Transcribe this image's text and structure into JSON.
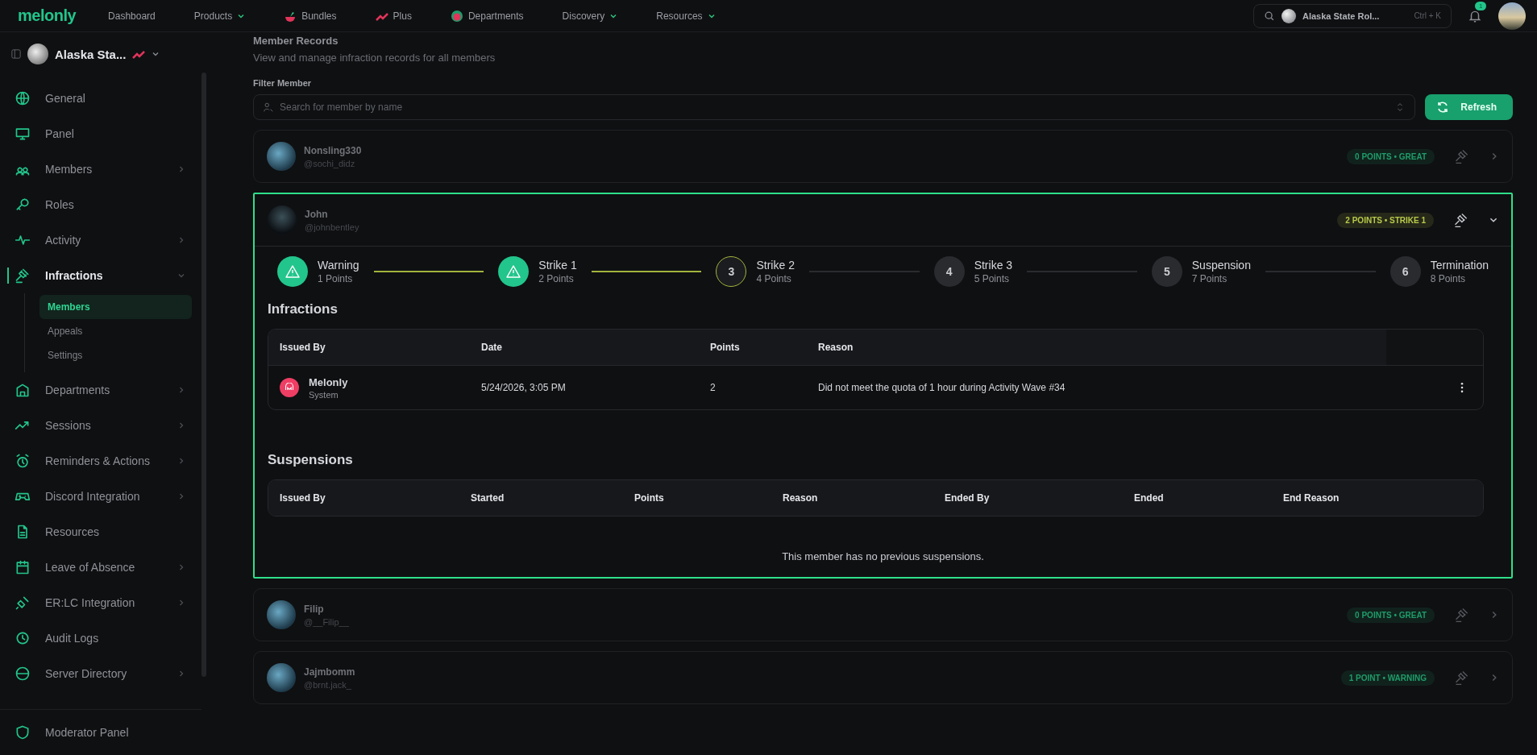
{
  "topbar": {
    "logo": "melonly",
    "nav": [
      {
        "label": "Dashboard",
        "dropdown": false
      },
      {
        "label": "Products",
        "dropdown": true
      },
      {
        "label": "Bundles",
        "dropdown": false
      },
      {
        "label": "Plus",
        "dropdown": false
      },
      {
        "label": "Departments",
        "dropdown": false
      },
      {
        "label": "Discovery",
        "dropdown": true
      },
      {
        "label": "Resources",
        "dropdown": true
      }
    ],
    "search": {
      "value": "Alaska State Rol...",
      "shortcut": "Ctrl + K"
    },
    "notifications": "1"
  },
  "sidebar": {
    "server": "Alaska Sta...",
    "items": [
      {
        "label": "General",
        "submenu": false,
        "active": false
      },
      {
        "label": "Panel",
        "submenu": false,
        "active": false
      },
      {
        "label": "Members",
        "submenu": true,
        "active": false,
        "expanded": false
      },
      {
        "label": "Roles",
        "submenu": false,
        "active": false
      },
      {
        "label": "Activity",
        "submenu": true,
        "active": false,
        "expanded": false
      },
      {
        "label": "Infractions",
        "submenu": true,
        "active": true,
        "expanded": true,
        "children": [
          {
            "label": "Members",
            "selected": true
          },
          {
            "label": "Appeals",
            "selected": false
          },
          {
            "label": "Settings",
            "selected": false
          }
        ]
      },
      {
        "label": "Departments",
        "submenu": true,
        "active": false,
        "expanded": false
      },
      {
        "label": "Sessions",
        "submenu": true,
        "active": false,
        "expanded": false
      },
      {
        "label": "Reminders & Actions",
        "submenu": true,
        "active": false,
        "expanded": false
      },
      {
        "label": "Discord Integration",
        "submenu": true,
        "active": false,
        "expanded": false
      },
      {
        "label": "Resources",
        "submenu": false,
        "active": false
      },
      {
        "label": "Leave of Absence",
        "submenu": true,
        "active": false,
        "expanded": false
      },
      {
        "label": "ER:LC Integration",
        "submenu": true,
        "active": false,
        "expanded": false
      },
      {
        "label": "Audit Logs",
        "submenu": false,
        "active": false
      },
      {
        "label": "Server Directory",
        "submenu": true,
        "active": false,
        "expanded": false
      }
    ],
    "footer": "Moderator Panel"
  },
  "page": {
    "title": "Member Records",
    "subtitle": "View and manage infraction records for all members",
    "filter_label": "Filter Member",
    "search": {
      "placeholder": "Search for member by name"
    },
    "refresh": "Refresh"
  },
  "members": [
    {
      "name": "Nonsling330",
      "handle": "@sochi_didz",
      "badge": "0 POINTS • GREAT",
      "color": "#1f9d6a",
      "expanded": false
    },
    {
      "name": "John",
      "handle": "@johnbentley",
      "badge": "2 POINTS • STRIKE 1",
      "color": "#b8c94a",
      "expanded": true,
      "steps": [
        {
          "label": "Warning",
          "points": "1 Points",
          "completed": true,
          "current": false
        },
        {
          "label": "Strike 1",
          "points": "2 Points",
          "completed": true,
          "current": false
        },
        {
          "number": "3",
          "label": "Strike 2",
          "points": "4 Points",
          "completed": false,
          "current": true
        },
        {
          "number": "4",
          "label": "Strike 3",
          "points": "5 Points",
          "completed": false,
          "current": false
        },
        {
          "number": "5",
          "label": "Suspension",
          "points": "7 Points",
          "completed": false,
          "current": false
        },
        {
          "number": "6",
          "label": "Termination",
          "points": "8 Points",
          "completed": false,
          "current": false
        }
      ],
      "infractions": {
        "title": "Infractions",
        "columns": [
          "Issued By",
          "Date",
          "Points",
          "Reason"
        ],
        "rows": [
          {
            "issuer": "Melonly",
            "issuer_role": "System",
            "date": "5/24/2026, 3:05 PM",
            "points": "2",
            "reason": "Did not meet the quota of 1 hour during Activity Wave #34"
          }
        ]
      },
      "suspensions": {
        "title": "Suspensions",
        "columns": [
          "Issued By",
          "Started",
          "Points",
          "Reason",
          "Ended By",
          "Ended",
          "End Reason"
        ],
        "empty": "This member has no previous suspensions."
      }
    },
    {
      "name": "Filip",
      "handle": "@__Filip__",
      "badge": "0 POINTS • GREAT",
      "color": "#1f9d6a",
      "expanded": false
    },
    {
      "name": "Jajmbomm",
      "handle": "@brnt.jack_",
      "badge": "1 POINT • WARNING",
      "color": "#1f9d6a",
      "expanded": false
    }
  ]
}
